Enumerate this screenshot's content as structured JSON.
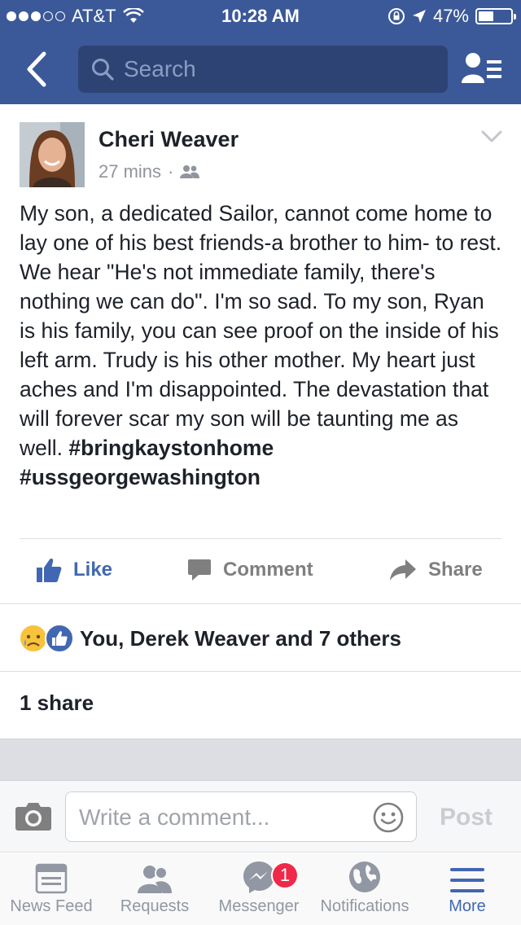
{
  "status": {
    "carrier": "AT&T",
    "time": "10:28 AM",
    "battery": "47%",
    "battery_level": 0.47
  },
  "nav": {
    "search_placeholder": "Search"
  },
  "post": {
    "author": "Cheri Weaver",
    "time": "27 mins",
    "body": "My son, a dedicated Sailor, cannot come home to lay one of his best friends-a brother to him- to rest.  We hear \"He's not immediate family, there's nothing we can do\".  I'm so sad.  To my son, Ryan is his family, you can see proof on the inside of his left arm.  Trudy is his other mother. My heart just aches and I'm disappointed. The devastation that will forever scar my son will be taunting me as well. ",
    "hashtags": [
      "#bringkaystonhome",
      "#ussgeorgewashington"
    ]
  },
  "actions": {
    "like": "Like",
    "comment": "Comment",
    "share": "Share"
  },
  "reactions": {
    "text": "You, Derek Weaver and 7 others"
  },
  "shares": {
    "text": "1 share"
  },
  "composer": {
    "placeholder": "Write a comment...",
    "post_label": "Post"
  },
  "tabs": [
    {
      "label": "News Feed",
      "icon": "news-feed-icon"
    },
    {
      "label": "Requests",
      "icon": "friend-requests-icon"
    },
    {
      "label": "Messenger",
      "icon": "messenger-icon",
      "badge": "1"
    },
    {
      "label": "Notifications",
      "icon": "globe-icon"
    },
    {
      "label": "More",
      "icon": "menu-icon",
      "active": true
    }
  ],
  "colors": {
    "brand": "#3b5998",
    "like_blue": "#4267b2",
    "badge_red": "#f02849"
  }
}
